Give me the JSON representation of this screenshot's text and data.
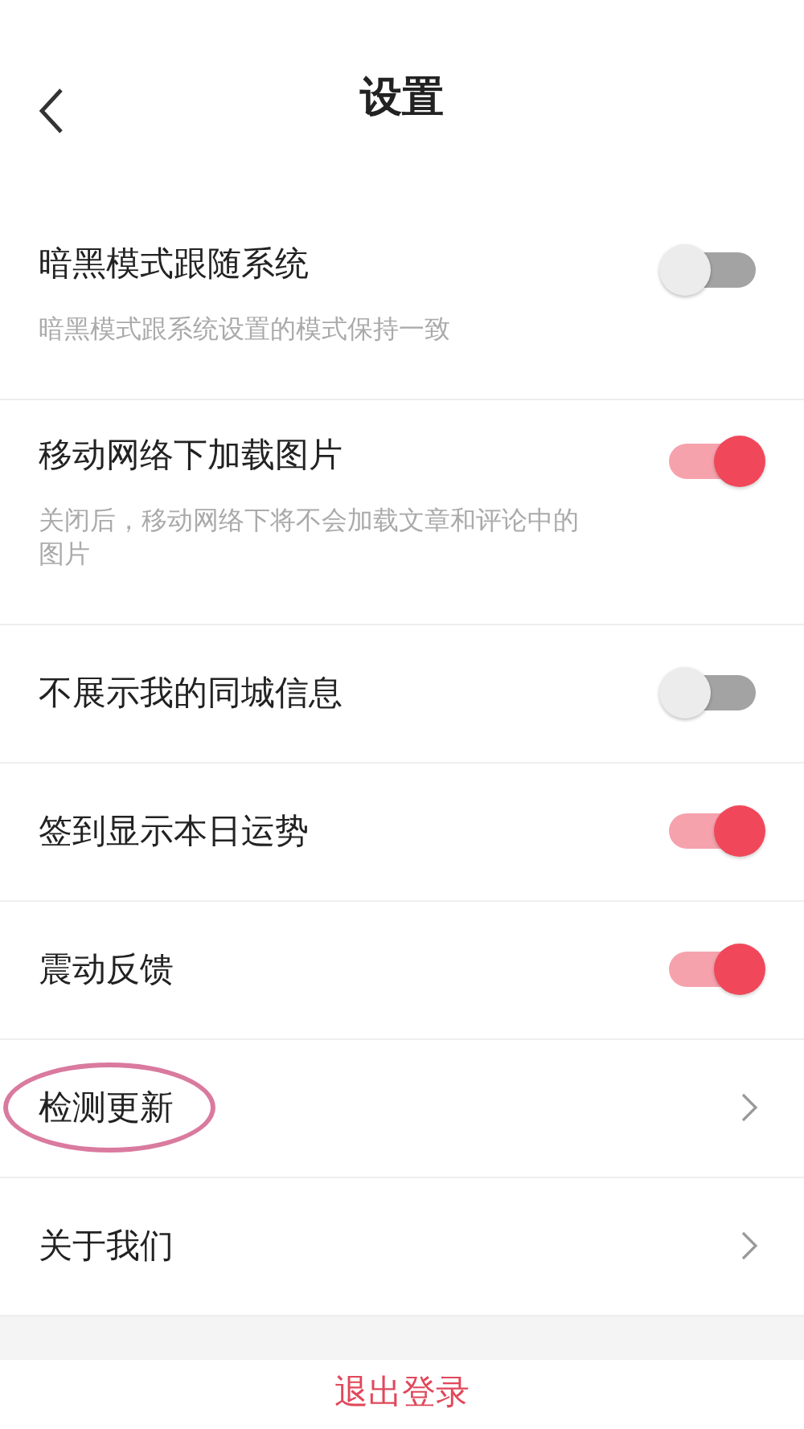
{
  "header": {
    "title": "设置"
  },
  "rows": [
    {
      "kind": "toggle",
      "label": "暗黑模式跟随系统",
      "description": "暗黑模式跟系统设置的模式保持一致",
      "on": false
    },
    {
      "kind": "toggle",
      "label": "移动网络下加载图片",
      "description": "关闭后，移动网络下将不会加载文章和评论中的图片",
      "on": true
    },
    {
      "kind": "toggle",
      "label": "不展示我的同城信息",
      "on": false
    },
    {
      "kind": "toggle",
      "label": "签到显示本日运势",
      "on": true
    },
    {
      "kind": "toggle",
      "label": "震动反馈",
      "on": true
    },
    {
      "kind": "link",
      "label": "检测更新",
      "circled": true
    },
    {
      "kind": "link",
      "label": "关于我们",
      "circled": false
    }
  ],
  "logout": {
    "label": "退出登录"
  }
}
